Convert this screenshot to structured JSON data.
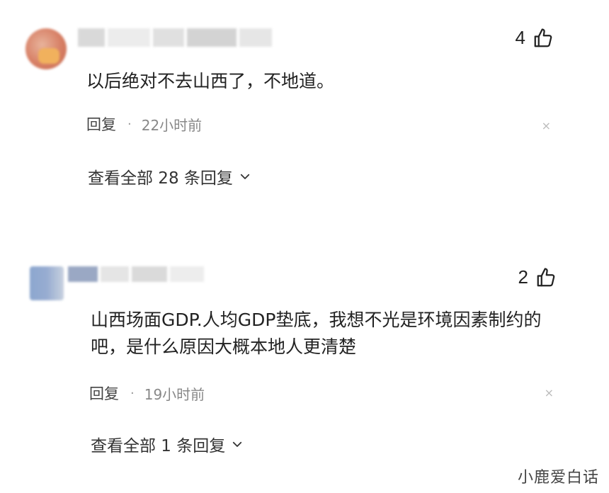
{
  "comments": [
    {
      "like_count": "4",
      "text": "以后绝对不去山西了，不地道。",
      "reply_label": "回复",
      "separator": "·",
      "time": "22小时前",
      "view_all": "查看全部 28 条回复",
      "close_glyph": "×"
    },
    {
      "like_count": "2",
      "text": "山西场面GDP.人均GDP垫底，我想不光是环境因素制约的吧，是什么原因大概本地人更清楚",
      "reply_label": "回复",
      "separator": "·",
      "time": "19小时前",
      "view_all": "查看全部 1 条回复",
      "close_glyph": "×"
    }
  ],
  "watermark": "小鹿爱白话",
  "icons": {
    "like": "thumbs-up-icon",
    "expand": "chevron-down-icon",
    "dismiss": "close-icon"
  }
}
